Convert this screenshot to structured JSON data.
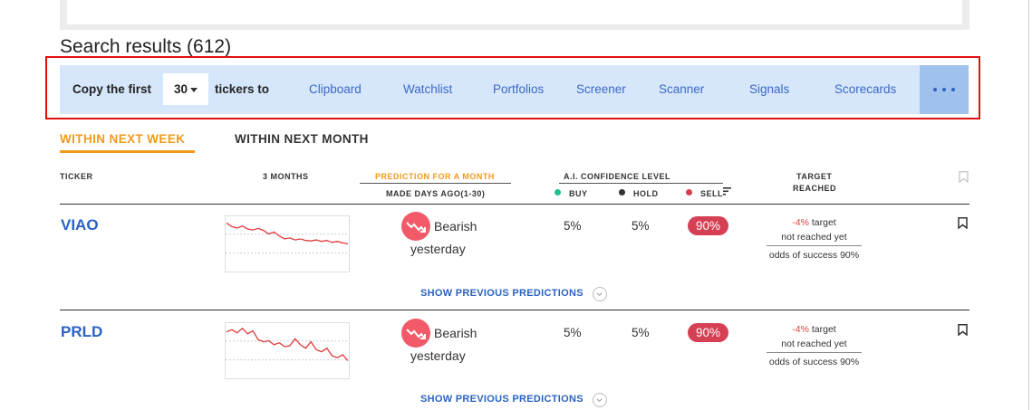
{
  "results": {
    "title": "Search results (612)"
  },
  "copy_bar": {
    "prefix": "Copy the first",
    "count": "30",
    "suffix": "tickers to",
    "destinations": [
      "Clipboard",
      "Watchlist",
      "Portfolios",
      "Screener",
      "Scanner",
      "Signals",
      "Scorecards"
    ],
    "more_icon": "ellipsis-icon",
    "background": "#d7e7fb",
    "more_background": "#9fc1ec"
  },
  "tabs": [
    {
      "label": "WITHIN NEXT WEEK",
      "active": true
    },
    {
      "label": "WITHIN NEXT MONTH",
      "active": false
    }
  ],
  "table_headers": {
    "ticker": "TICKER",
    "months": "3 MONTHS",
    "prediction": "PREDICTION FOR A MONTH",
    "made_days": "MADE DAYS AGO(1-30)",
    "confidence": "A.I. CONFIDENCE LEVEL",
    "buy": "BUY",
    "hold": "HOLD",
    "sell": "SELL",
    "target": "TARGET",
    "reached": "REACHED"
  },
  "colors": {
    "accent_orange": "#f29a1d",
    "link_blue": "#2b62c4",
    "bearish_red": "#d64055",
    "buy_green": "#1fbf8f",
    "hold_dark": "#333333"
  },
  "rows": [
    {
      "ticker": "VIAO",
      "sparkline": [
        0.92,
        0.85,
        0.82,
        0.86,
        0.8,
        0.78,
        0.81,
        0.77,
        0.7,
        0.74,
        0.66,
        0.6,
        0.62,
        0.58,
        0.6,
        0.57,
        0.56,
        0.58,
        0.55,
        0.57,
        0.53,
        0.55,
        0.52,
        0.5
      ],
      "prediction": "Bearish",
      "made": "yesterday",
      "buy": "5%",
      "hold": "5%",
      "sell": "90%",
      "target_pct": "-4%",
      "target_word": "target",
      "not_reached": "not reached yet",
      "odds": "odds of success 90%",
      "show_prev": "SHOW PREVIOUS PREDICTIONS"
    },
    {
      "ticker": "PRLD",
      "sparkline": [
        0.88,
        0.92,
        0.86,
        0.95,
        0.84,
        0.9,
        0.72,
        0.68,
        0.7,
        0.62,
        0.66,
        0.58,
        0.6,
        0.74,
        0.62,
        0.55,
        0.68,
        0.52,
        0.48,
        0.55,
        0.4,
        0.36,
        0.42,
        0.3
      ],
      "prediction": "Bearish",
      "made": "yesterday",
      "buy": "5%",
      "hold": "5%",
      "sell": "90%",
      "target_pct": "-4%",
      "target_word": "target",
      "not_reached": "not reached yet",
      "odds": "odds of success 90%",
      "show_prev": "SHOW PREVIOUS PREDICTIONS"
    }
  ]
}
